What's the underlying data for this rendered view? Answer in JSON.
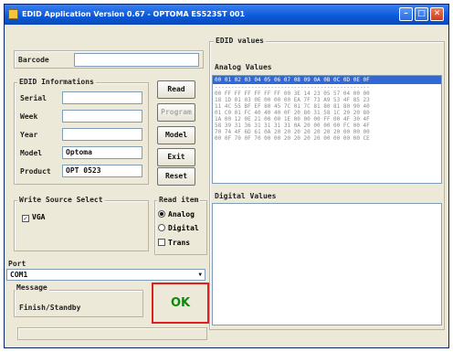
{
  "window": {
    "title": "EDID Application Version 0.67 - OPTOMA ES523ST 001"
  },
  "barcode": {
    "label": "Barcode",
    "value": ""
  },
  "edid_info": {
    "title": "EDID Informations",
    "serial_label": "Serial",
    "serial_value": "",
    "week_label": "Week",
    "week_value": "",
    "year_label": "Year",
    "year_value": "",
    "model_label": "Model",
    "model_value": "Optoma",
    "product_label": "Product",
    "product_value": "OPT 0523"
  },
  "buttons": {
    "read": "Read",
    "program": "Program",
    "model": "Model",
    "exit": "Exit",
    "reset": "Reset"
  },
  "write_source": {
    "title": "Write Source Select",
    "vga_label": "VGA",
    "vga_checked": true
  },
  "read_item": {
    "title": "Read item",
    "options": [
      {
        "label": "Analog",
        "selected": true
      },
      {
        "label": "Digital",
        "selected": false
      }
    ],
    "trans_label": "Trans"
  },
  "port": {
    "label": "Port",
    "value": "COM1"
  },
  "message": {
    "title": "Message",
    "text": "Finish/Standby",
    "status": "OK"
  },
  "edid_values": {
    "title": "EDID values",
    "analog_title": "Analog Values",
    "header_row": "00 01 02 03 04 05 06 07 08 09 0A 0B 0C 0D 0E 0F",
    "divider": "-----------------------------------------------",
    "rows": [
      "00 FF FF FF FF FF FF 00 3E 14 23 05 57 04 00 00",
      "18 1D 01 03 0E 00 00 00 EA 7F 73 A9 53 4F 85 23",
      "11 4C 55 BF EF 80 45 7C 01 7C 81 80 81 80 90 40",
      "01 C0 01 FC 40 40 40 0F 20 80 31 58 1C 20 20 80",
      "1A 00 12 0E 21 00 00 1E 00 00 00 FF 00 4F 30 4F",
      "58 39 31 36 31 31 31 31 0A 20 00 00 00 FC 00 4F",
      "70 74 4F 6D 61 0A 20 20 20 20 20 20 20 00 00 00",
      "00 0F 70 0F 70 00 00 20 20 20 20 00 00 00 00 CE"
    ],
    "digital_title": "Digital Values"
  }
}
